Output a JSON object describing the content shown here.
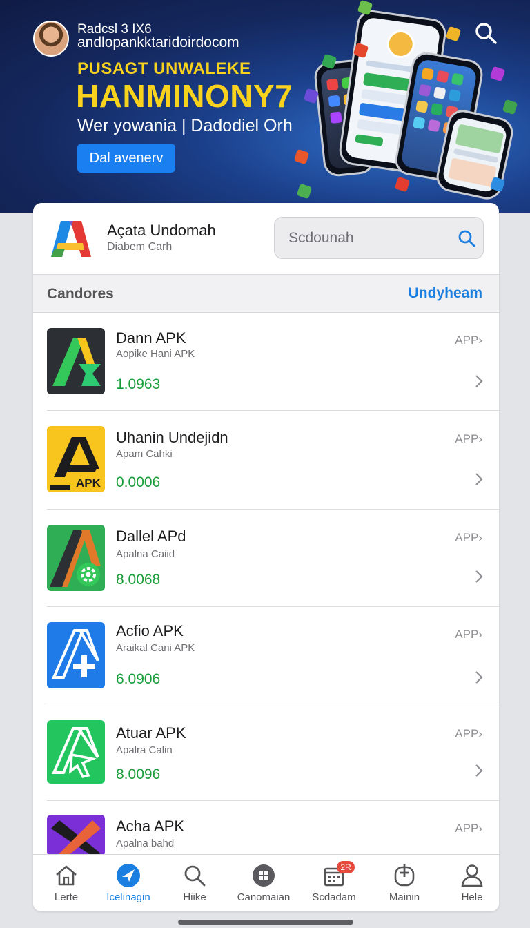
{
  "banner": {
    "user_line1": "Radcsl 3 IX6",
    "user_line2": "andlopankktaridoirdocom",
    "kicker": "PUSAGT UNWALEKE",
    "title": "HANMINONY7",
    "subtitle": "Wer yowania | Dadodiel Orh",
    "button_label": "Dal avenerv"
  },
  "header": {
    "app_title": "Açata Undomah",
    "app_subtitle": "Diabem Carh",
    "search_placeholder": "Scdounah"
  },
  "section": {
    "title": "Candores",
    "link_label": "Undyheam"
  },
  "apps": [
    {
      "name": "Dann APK",
      "subtitle": "Aopike Hani APK",
      "size": "1.0963",
      "type": "APP",
      "icon": "arrow-a-dark-icon"
    },
    {
      "name": "Uhanin Undejidn",
      "subtitle": "Apam Cahki",
      "size": "0.0006",
      "type": "APP",
      "icon": "apk-yellow-icon",
      "icon_text": "APK"
    },
    {
      "name": "Dallel APd",
      "subtitle": "Apalna Caiid",
      "size": "8.0068",
      "type": "APP",
      "icon": "gear-a-green-icon"
    },
    {
      "name": "Acfio APK",
      "subtitle": "Araikal Cani APK",
      "size": "6.0906",
      "type": "APP",
      "icon": "a-plus-blue-icon"
    },
    {
      "name": "Atuar APK",
      "subtitle": "Apalra Calin",
      "size": "8.0096",
      "type": "APP",
      "icon": "a-outline-green-icon"
    },
    {
      "name": "Acha APK",
      "subtitle": "Apalna bahd",
      "size": "",
      "type": "APP",
      "icon": "x-purple-icon"
    }
  ],
  "tabs": [
    {
      "label": "Lerte",
      "icon": "home-icon"
    },
    {
      "label": "Icelinagin",
      "icon": "compass-icon",
      "active": true
    },
    {
      "label": "Hiike",
      "icon": "search-icon"
    },
    {
      "label": "Canomaian",
      "icon": "grid-icon"
    },
    {
      "label": "Scdadam",
      "icon": "calendar-icon",
      "badge": "2R"
    },
    {
      "label": "Mainin",
      "icon": "phone-icon"
    },
    {
      "label": "Hele",
      "icon": "person-icon"
    }
  ],
  "colors": {
    "accent": "#1a7fe0",
    "size_green": "#1a9e3a",
    "promo_yellow": "#f8d21c",
    "badge_red": "#e54b3c"
  }
}
